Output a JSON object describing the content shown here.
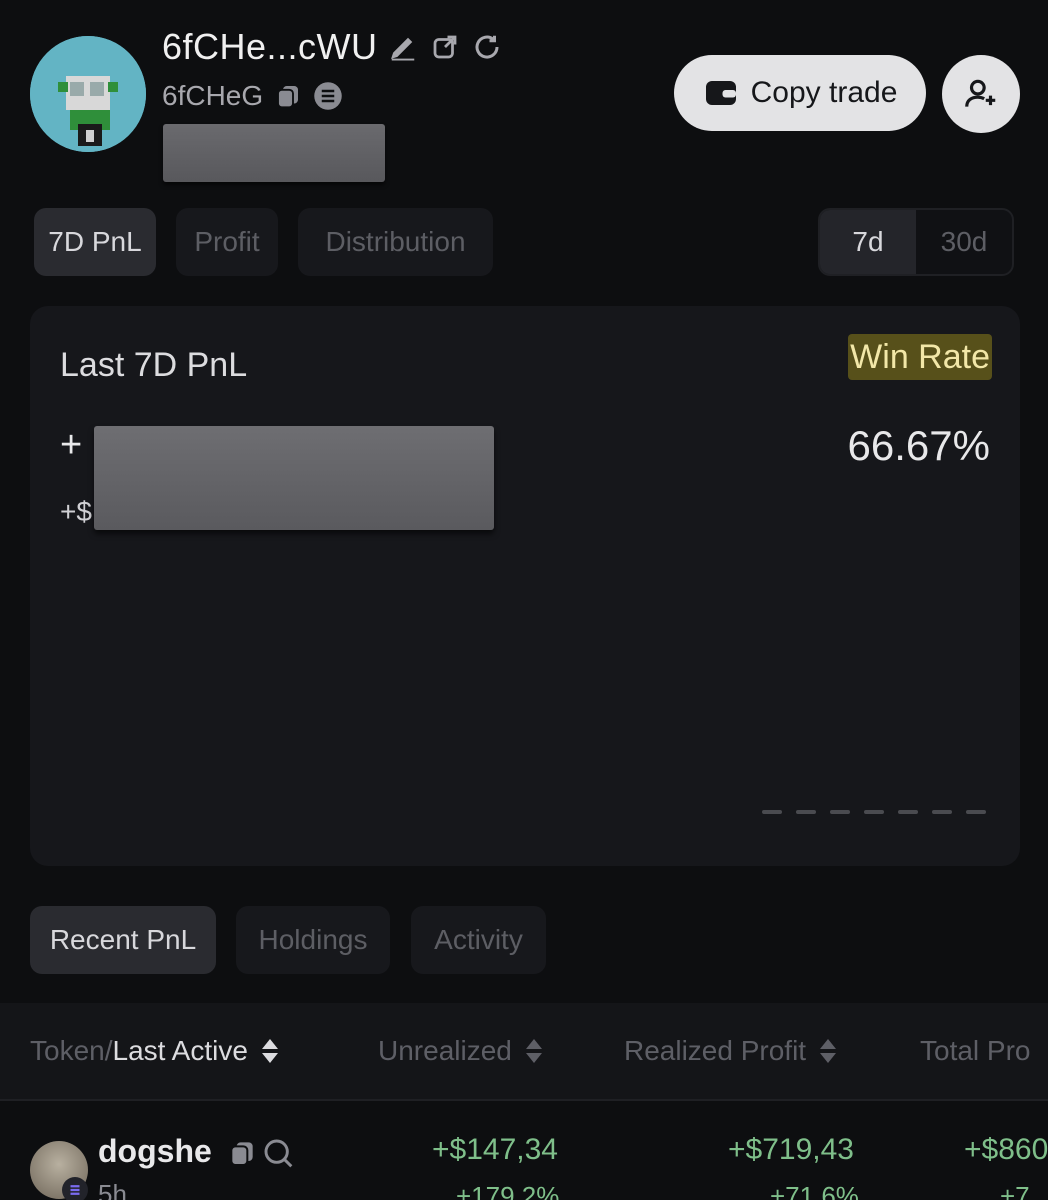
{
  "header": {
    "wallet_name": "6fCHe...cWU",
    "wallet_short": "6fCHeG",
    "copy_trade_label": "Copy trade",
    "icons": [
      "pencil-icon",
      "external-link-icon",
      "refresh-icon",
      "copy-icon",
      "solana-icon",
      "wallet-icon",
      "add-user-icon"
    ]
  },
  "tabs": [
    {
      "label": "7D PnL",
      "active": true
    },
    {
      "label": "Profit",
      "active": false
    },
    {
      "label": "Distribution",
      "active": false
    }
  ],
  "period": {
    "options": [
      "7d",
      "30d"
    ],
    "selected": "7d"
  },
  "pnl_card": {
    "title": "Last 7D PnL",
    "plus_sign": "+",
    "dollar_prefix": "+$",
    "win_rate_label": "Win Rate",
    "win_rate_value": "66.67%",
    "highlight_color": "#57501a"
  },
  "bottom_tabs": [
    {
      "label": "Recent PnL",
      "active": true
    },
    {
      "label": "Holdings",
      "active": false
    },
    {
      "label": "Activity",
      "active": false
    }
  ],
  "table": {
    "headers": {
      "token_prefix": "Token/",
      "last_active": "Last Active",
      "unrealized": "Unrealized",
      "realized_profit": "Realized Profit",
      "total_profit": "Total Pro"
    },
    "rows": [
      {
        "token": "dogshe",
        "time": "5h",
        "unrealized": "+$147,34",
        "unrealized_pct": "+179.2%",
        "realized": "+$719,43",
        "realized_pct": "+71.6%",
        "total": "+$860",
        "total_pct": "+7"
      }
    ],
    "positive_color": "#7fbf8a"
  }
}
